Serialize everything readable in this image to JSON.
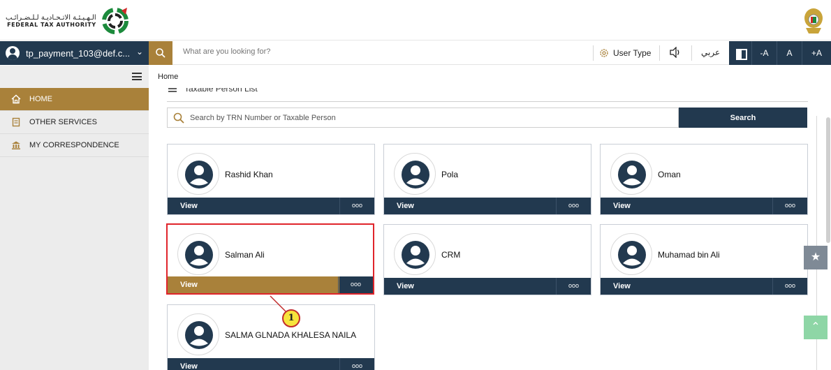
{
  "header": {
    "logo_ar": "الـهـيـئـة الاتـحـاديـة لـلـضـرائـب",
    "logo_en": "FEDERAL TAX AUTHORITY",
    "logo_icon": "fta-logo-icon",
    "emblem_icon": "uae-emblem-icon"
  },
  "topbar": {
    "account": "tp_payment_103@def.c...",
    "search_placeholder": "What are you looking for?",
    "user_type": "User Type",
    "arabic": "عربي",
    "font_decrease": "-A",
    "font_normal": "A",
    "font_increase": "+A"
  },
  "breadcrumb": "Home",
  "sidebar": {
    "items": [
      {
        "label": "HOME",
        "icon": "home-icon"
      },
      {
        "label": "OTHER SERVICES",
        "icon": "document-icon"
      },
      {
        "label": "MY CORRESPONDENCE",
        "icon": "building-icon"
      }
    ]
  },
  "main": {
    "section_title": "Taxable Person List",
    "search_placeholder": "Search by TRN Number or Taxable Person",
    "search_button": "Search",
    "view_label": "View",
    "more_label": "ooo",
    "persons": [
      "Rashid Khan",
      "Pola",
      "Oman",
      "Salman Ali",
      "CRM",
      "Muhamad bin Ali",
      "SALMA GLNADA KHALESA NAILA"
    ],
    "highlighted_index": 3
  },
  "annotation": {
    "number": "1"
  },
  "colors": {
    "navy": "#22394f",
    "gold": "#a9813a",
    "highlight": "#e0242b"
  }
}
